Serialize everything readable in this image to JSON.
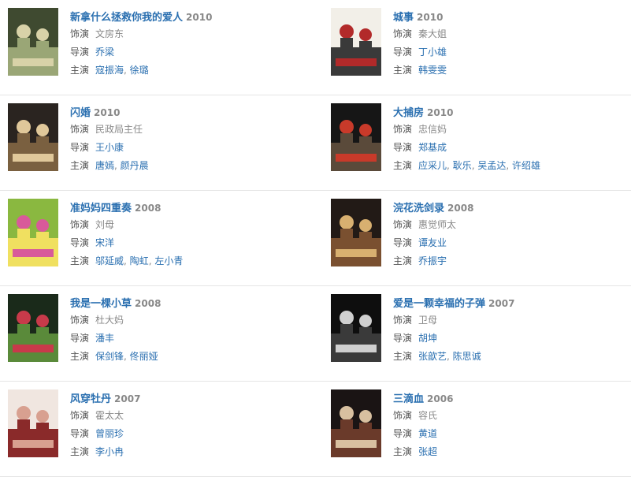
{
  "labels": {
    "role": "饰演",
    "director": "导演",
    "cast": "主演"
  },
  "rows": [
    [
      {
        "title": "新拿什么拯救你我的爱人",
        "year": "2010",
        "role": "文房东",
        "director": "乔梁",
        "cast": [
          "寇振海",
          "徐璐"
        ],
        "colors": [
          "#3f4a30",
          "#9aa676",
          "#d8d2a8"
        ]
      },
      {
        "title": "城事",
        "year": "2010",
        "role": "秦大姐",
        "director": "丁小雄",
        "cast": [
          "韩雯雯"
        ],
        "colors": [
          "#f2efe8",
          "#3a3a3a",
          "#b22a2a"
        ]
      }
    ],
    [
      {
        "title": "闪婚",
        "year": "2010",
        "role": "民政局主任",
        "director": "王小康",
        "cast": [
          "唐嫣",
          "颜丹晨"
        ],
        "colors": [
          "#2a2420",
          "#7a6040",
          "#e0c89a"
        ]
      },
      {
        "title": "大捕房",
        "year": "2010",
        "role": "忠信妈",
        "director": "郑基成",
        "cast": [
          "应采儿",
          "耿乐",
          "吴孟达",
          "许绍雄"
        ],
        "colors": [
          "#161616",
          "#5a4a3a",
          "#c83a2a"
        ]
      }
    ],
    [
      {
        "title": "准妈妈四重奏",
        "year": "2008",
        "role": "刘母",
        "director": "宋洋",
        "cast": [
          "邬延威",
          "陶虹",
          "左小青"
        ],
        "colors": [
          "#8ab840",
          "#f0e060",
          "#d85a9a"
        ]
      },
      {
        "title": "浣花洗剑录",
        "year": "2008",
        "role": "惠觉师太",
        "director": "谭友业",
        "cast": [
          "乔振宇"
        ],
        "colors": [
          "#221a16",
          "#7a5030",
          "#d8b070"
        ]
      }
    ],
    [
      {
        "title": "我是一棵小草",
        "year": "2008",
        "role": "杜大妈",
        "director": "潘丰",
        "cast": [
          "保剑锋",
          "佟丽娅"
        ],
        "colors": [
          "#1a2a1a",
          "#5a8a3a",
          "#c83a4a"
        ]
      },
      {
        "title": "爱是一颗幸福的子弹",
        "year": "2007",
        "role": "卫母",
        "director": "胡坤",
        "cast": [
          "张歆艺",
          "陈思诚"
        ],
        "colors": [
          "#0e0e0e",
          "#3a3a3a",
          "#cfcfcf"
        ]
      }
    ],
    [
      {
        "title": "风穿牡丹",
        "year": "2007",
        "role": "霍太太",
        "director": "曾丽珍",
        "cast": [
          "李小冉"
        ],
        "colors": [
          "#f0e6e0",
          "#8a2a2a",
          "#d8a090"
        ]
      },
      {
        "title": "三滴血",
        "year": "2006",
        "role": "容氏",
        "director": "黄道",
        "cast": [
          "张超"
        ],
        "colors": [
          "#1a1414",
          "#6a3a2a",
          "#d8c0a0"
        ]
      }
    ]
  ]
}
